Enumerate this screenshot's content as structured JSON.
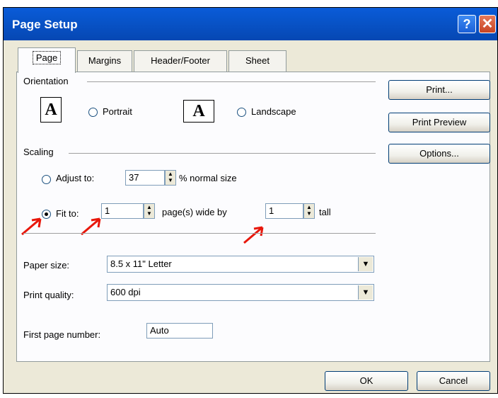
{
  "window": {
    "title": "Page Setup",
    "help_glyph": "?",
    "close_glyph": "✕"
  },
  "tabs": [
    {
      "label": "Page",
      "active": true
    },
    {
      "label": "Margins",
      "active": false
    },
    {
      "label": "Header/Footer",
      "active": false
    },
    {
      "label": "Sheet",
      "active": false
    }
  ],
  "orientation": {
    "heading": "Orientation",
    "portrait_icon_glyph": "A",
    "landscape_icon_glyph": "A",
    "portrait_label": "Portrait",
    "landscape_label": "Landscape",
    "selected": "Portrait"
  },
  "scaling": {
    "heading": "Scaling",
    "adjust_label": "Adjust to:",
    "adjust_value": "37",
    "adjust_suffix": "% normal size",
    "fit_label": "Fit to:",
    "fit_wide_value": "1",
    "fit_wide_suffix": "page(s) wide by",
    "fit_tall_value": "1",
    "fit_tall_suffix": "tall",
    "selected": "Fit to:"
  },
  "paper_size": {
    "label": "Paper size:",
    "value": "8.5 x 11\" Letter"
  },
  "print_quality": {
    "label": "Print quality:",
    "value": "600 dpi"
  },
  "first_page_number": {
    "label": "First page number:",
    "value": "Auto"
  },
  "side_buttons": {
    "print": "Print...",
    "print_preview": "Print Preview",
    "options": "Options..."
  },
  "footer_buttons": {
    "ok": "OK",
    "cancel": "Cancel"
  },
  "annotation_color": "#e8170b"
}
